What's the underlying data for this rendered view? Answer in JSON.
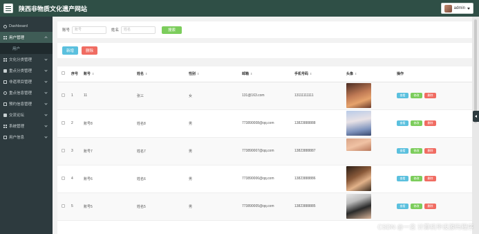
{
  "header": {
    "title": "陕西非物质文化遗产网站",
    "username": "admin"
  },
  "sidebar": {
    "dashboard": "Dashboard",
    "items": [
      {
        "label": "用户管理",
        "sub": "用户"
      },
      {
        "label": "文化分类管理"
      },
      {
        "label": "重点分类管理"
      },
      {
        "label": "非遗项目管理"
      },
      {
        "label": "重点信息管理"
      },
      {
        "label": "预约信息管理"
      },
      {
        "label": "交流论坛"
      },
      {
        "label": "系统管理"
      },
      {
        "label": "用户信息"
      }
    ]
  },
  "search": {
    "account_label": "账号",
    "account_placeholder": "账号",
    "name_label": "姓名",
    "name_placeholder": "姓名",
    "button": "搜索"
  },
  "actions": {
    "add": "新增",
    "delete": "删除"
  },
  "table": {
    "headers": [
      "序号",
      "账号",
      "姓名",
      "性别",
      "邮箱",
      "手机号码",
      "头像",
      "操作"
    ],
    "rows": [
      {
        "index": "1",
        "account": "11",
        "name": "张三",
        "gender": "女",
        "email": "131@163.com",
        "phone": "13111111111"
      },
      {
        "index": "2",
        "account": "账号8",
        "name": "姓名8",
        "gender": "男",
        "email": "773890008@qq.com",
        "phone": "13823888888"
      },
      {
        "index": "3",
        "account": "账号7",
        "name": "姓名7",
        "gender": "男",
        "email": "773890007@qq.com",
        "phone": "13823888887"
      },
      {
        "index": "4",
        "account": "账号6",
        "name": "姓名6",
        "gender": "男",
        "email": "773890006@qq.com",
        "phone": "13823888886"
      },
      {
        "index": "5",
        "account": "账号5",
        "name": "姓名5",
        "gender": "男",
        "email": "773890005@qq.com",
        "phone": "13823888885"
      }
    ],
    "ops": {
      "view": "查看",
      "edit": "修改",
      "delete": "删除"
    }
  },
  "watermark": "CSDN @一念 计算机毕设源码程序",
  "colors": {
    "topbar": "#2f4f46",
    "sidebar": "#2d3a3e",
    "green": "#7ccd5c",
    "blue": "#5bc0de",
    "red": "#f06c62"
  }
}
